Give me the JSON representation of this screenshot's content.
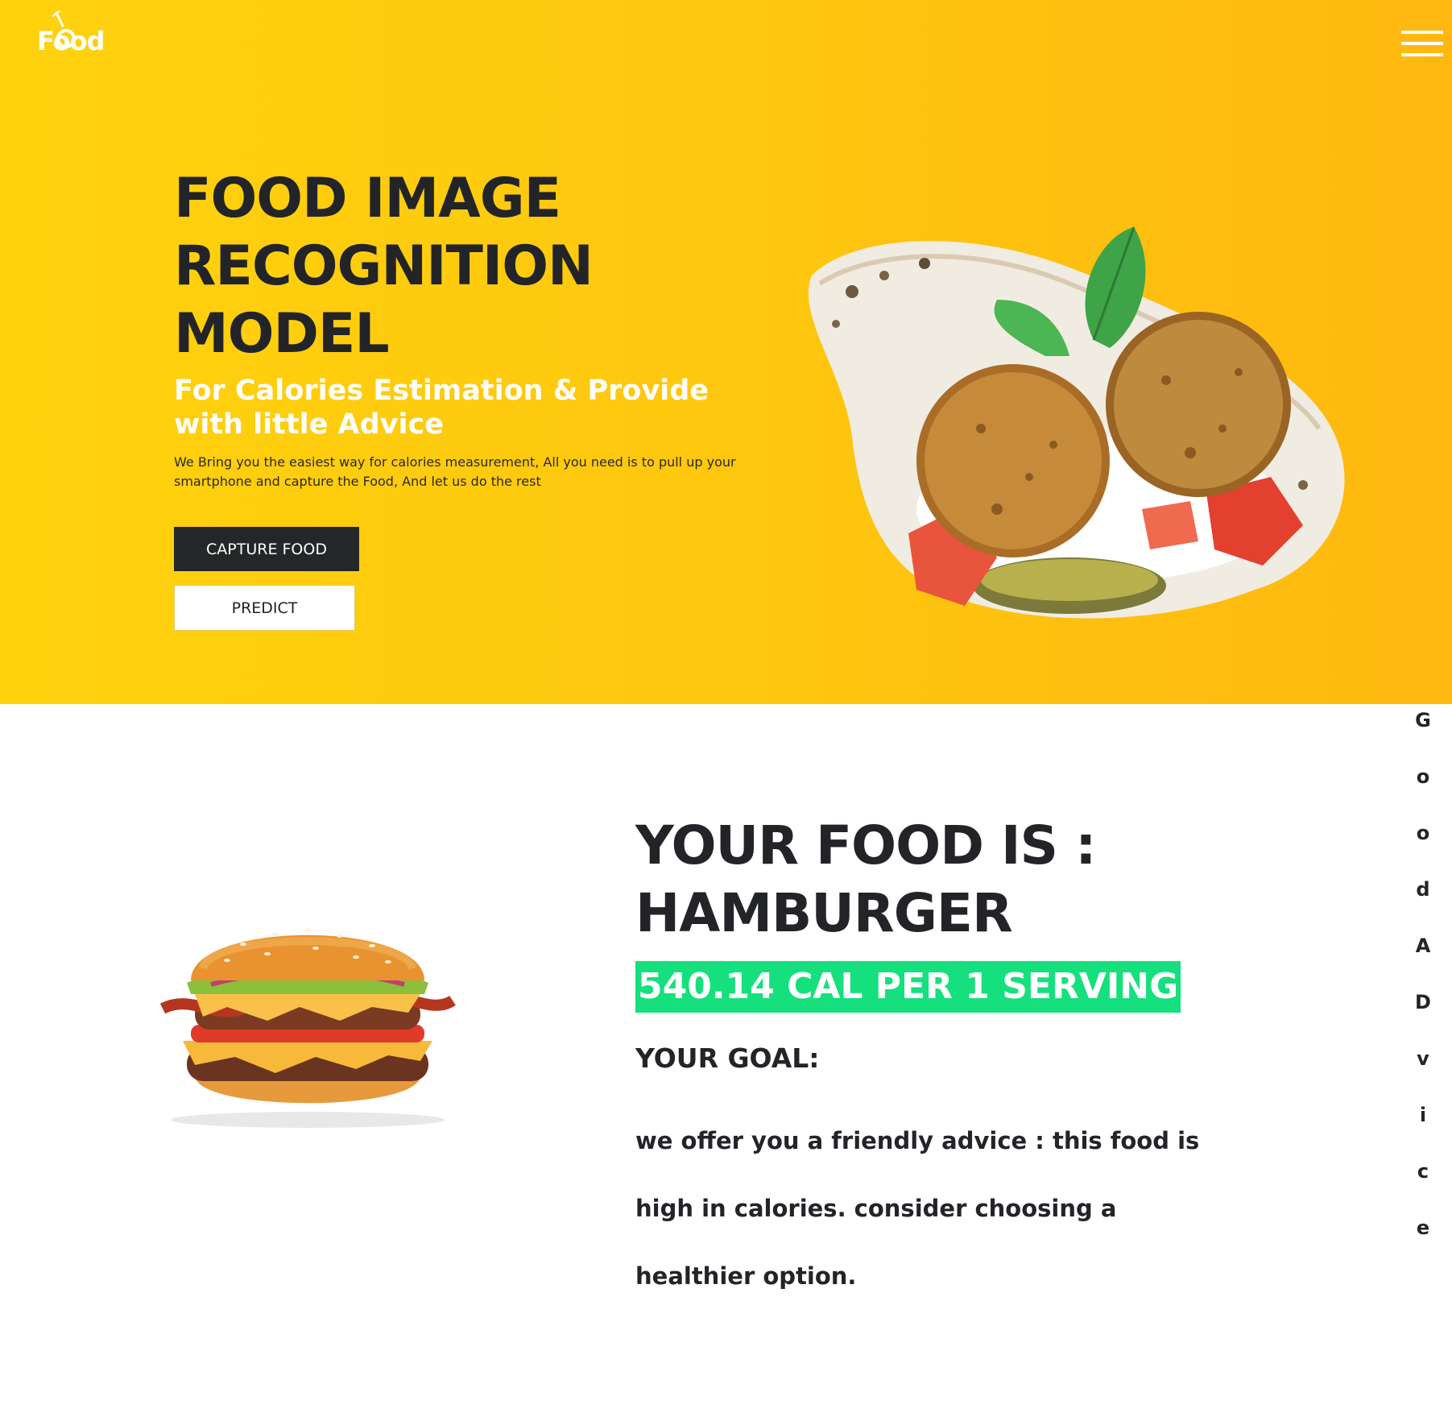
{
  "brand": {
    "logo_text": "Food"
  },
  "header": {
    "menu_icon": "hamburger-menu-icon"
  },
  "hero": {
    "title": "FOOD IMAGE RECOGNITION MODEL",
    "subtitle": "For Calories Estimation & Provide with little Advice",
    "description": "We Bring you the easiest way for calories measurement, All you need is to pull up your smartphone and capture the Food, And let us do the rest",
    "capture_label": "CAPTURE FOOD",
    "predict_label": "PREDICT",
    "image": "falafel-wrap-image"
  },
  "result": {
    "title": "YOUR FOOD IS : HAMBURGER",
    "calories": "540.14 CAL PER 1 SERVING",
    "goal_label": "YOUR GOAL:",
    "advice": "we offer you a friendly advice : this food is high in calories. consider choosing a healthier option.",
    "image": "hamburger-image",
    "side_letters": [
      "G",
      "o",
      "o",
      "d",
      "A",
      "D",
      "v",
      "i",
      "c",
      "e"
    ]
  },
  "colors": {
    "hero_bg_start": "#ffd20e",
    "hero_bg_end": "#ffb810",
    "text_dark": "#222428",
    "calorie_badge": "#15e07d",
    "button_dark": "#242628"
  }
}
